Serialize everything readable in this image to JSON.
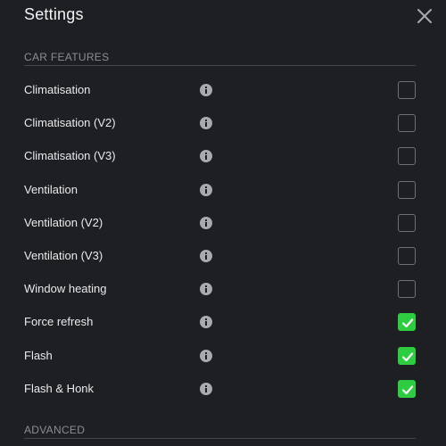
{
  "dialog": {
    "title": "Settings",
    "close_icon": "close-icon"
  },
  "sections": {
    "car_features": "CAR FEATURES",
    "advanced": "ADVANCED"
  },
  "rows": [
    {
      "label": "Climatisation",
      "checked": false
    },
    {
      "label": "Climatisation (V2)",
      "checked": false
    },
    {
      "label": "Climatisation (V3)",
      "checked": false
    },
    {
      "label": "Ventilation",
      "checked": false
    },
    {
      "label": "Ventilation (V2)",
      "checked": false
    },
    {
      "label": "Ventilation (V3)",
      "checked": false
    },
    {
      "label": "Window heating",
      "checked": false
    },
    {
      "label": "Force refresh",
      "checked": true
    },
    {
      "label": "Flash",
      "checked": true
    },
    {
      "label": "Flash & Honk",
      "checked": true
    }
  ],
  "colors": {
    "background": "#1e1f23",
    "checked": "#2ecc40",
    "section_text": "#8c8d93",
    "info_icon": "#a9aab0"
  }
}
